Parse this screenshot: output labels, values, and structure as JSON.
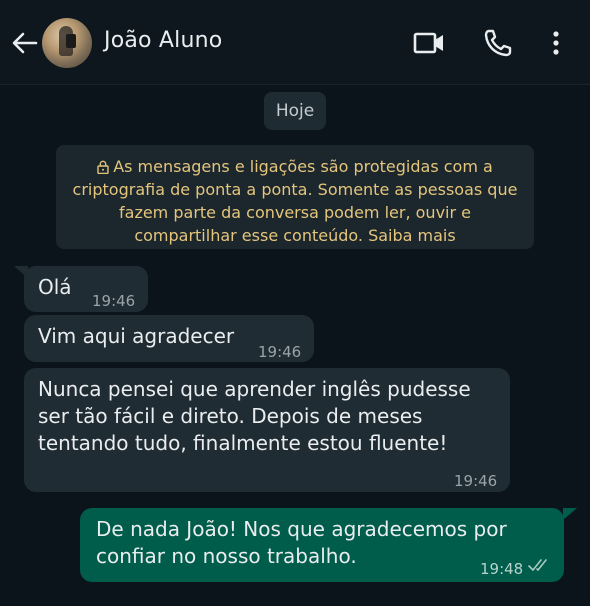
{
  "header": {
    "contact_name": "João Aluno",
    "back_icon": "arrow-left-icon",
    "video_icon": "video-camera-icon",
    "call_icon": "phone-icon",
    "menu_icon": "more-vertical-icon"
  },
  "chat": {
    "date_chip": "Hoje",
    "encryption_notice": "As mensagens e ligações são protegidas com a criptografia de ponta a ponta. Somente as pessoas que fazem parte da conversa podem ler, ouvir e compartilhar esse conteúdo. Saiba mais",
    "messages": [
      {
        "direction": "incoming",
        "text": "Olá",
        "time": "19:46"
      },
      {
        "direction": "incoming",
        "text": "Vim aqui agradecer",
        "time": "19:46"
      },
      {
        "direction": "incoming",
        "text": "Nunca pensei que aprender inglês pudesse ser tão fácil e direto. Depois de meses tentando tudo, finalmente estou fluente!",
        "time": "19:46"
      },
      {
        "direction": "outgoing",
        "text": "De nada João! Nos que agradecemos por confiar no nosso trabalho.",
        "time": "19:48",
        "status": "read-double-check"
      }
    ]
  },
  "colors": {
    "background": "#0b141a",
    "incoming_bubble": "#202c33",
    "outgoing_bubble": "#005c4b",
    "notice_text": "#e4c57c"
  }
}
